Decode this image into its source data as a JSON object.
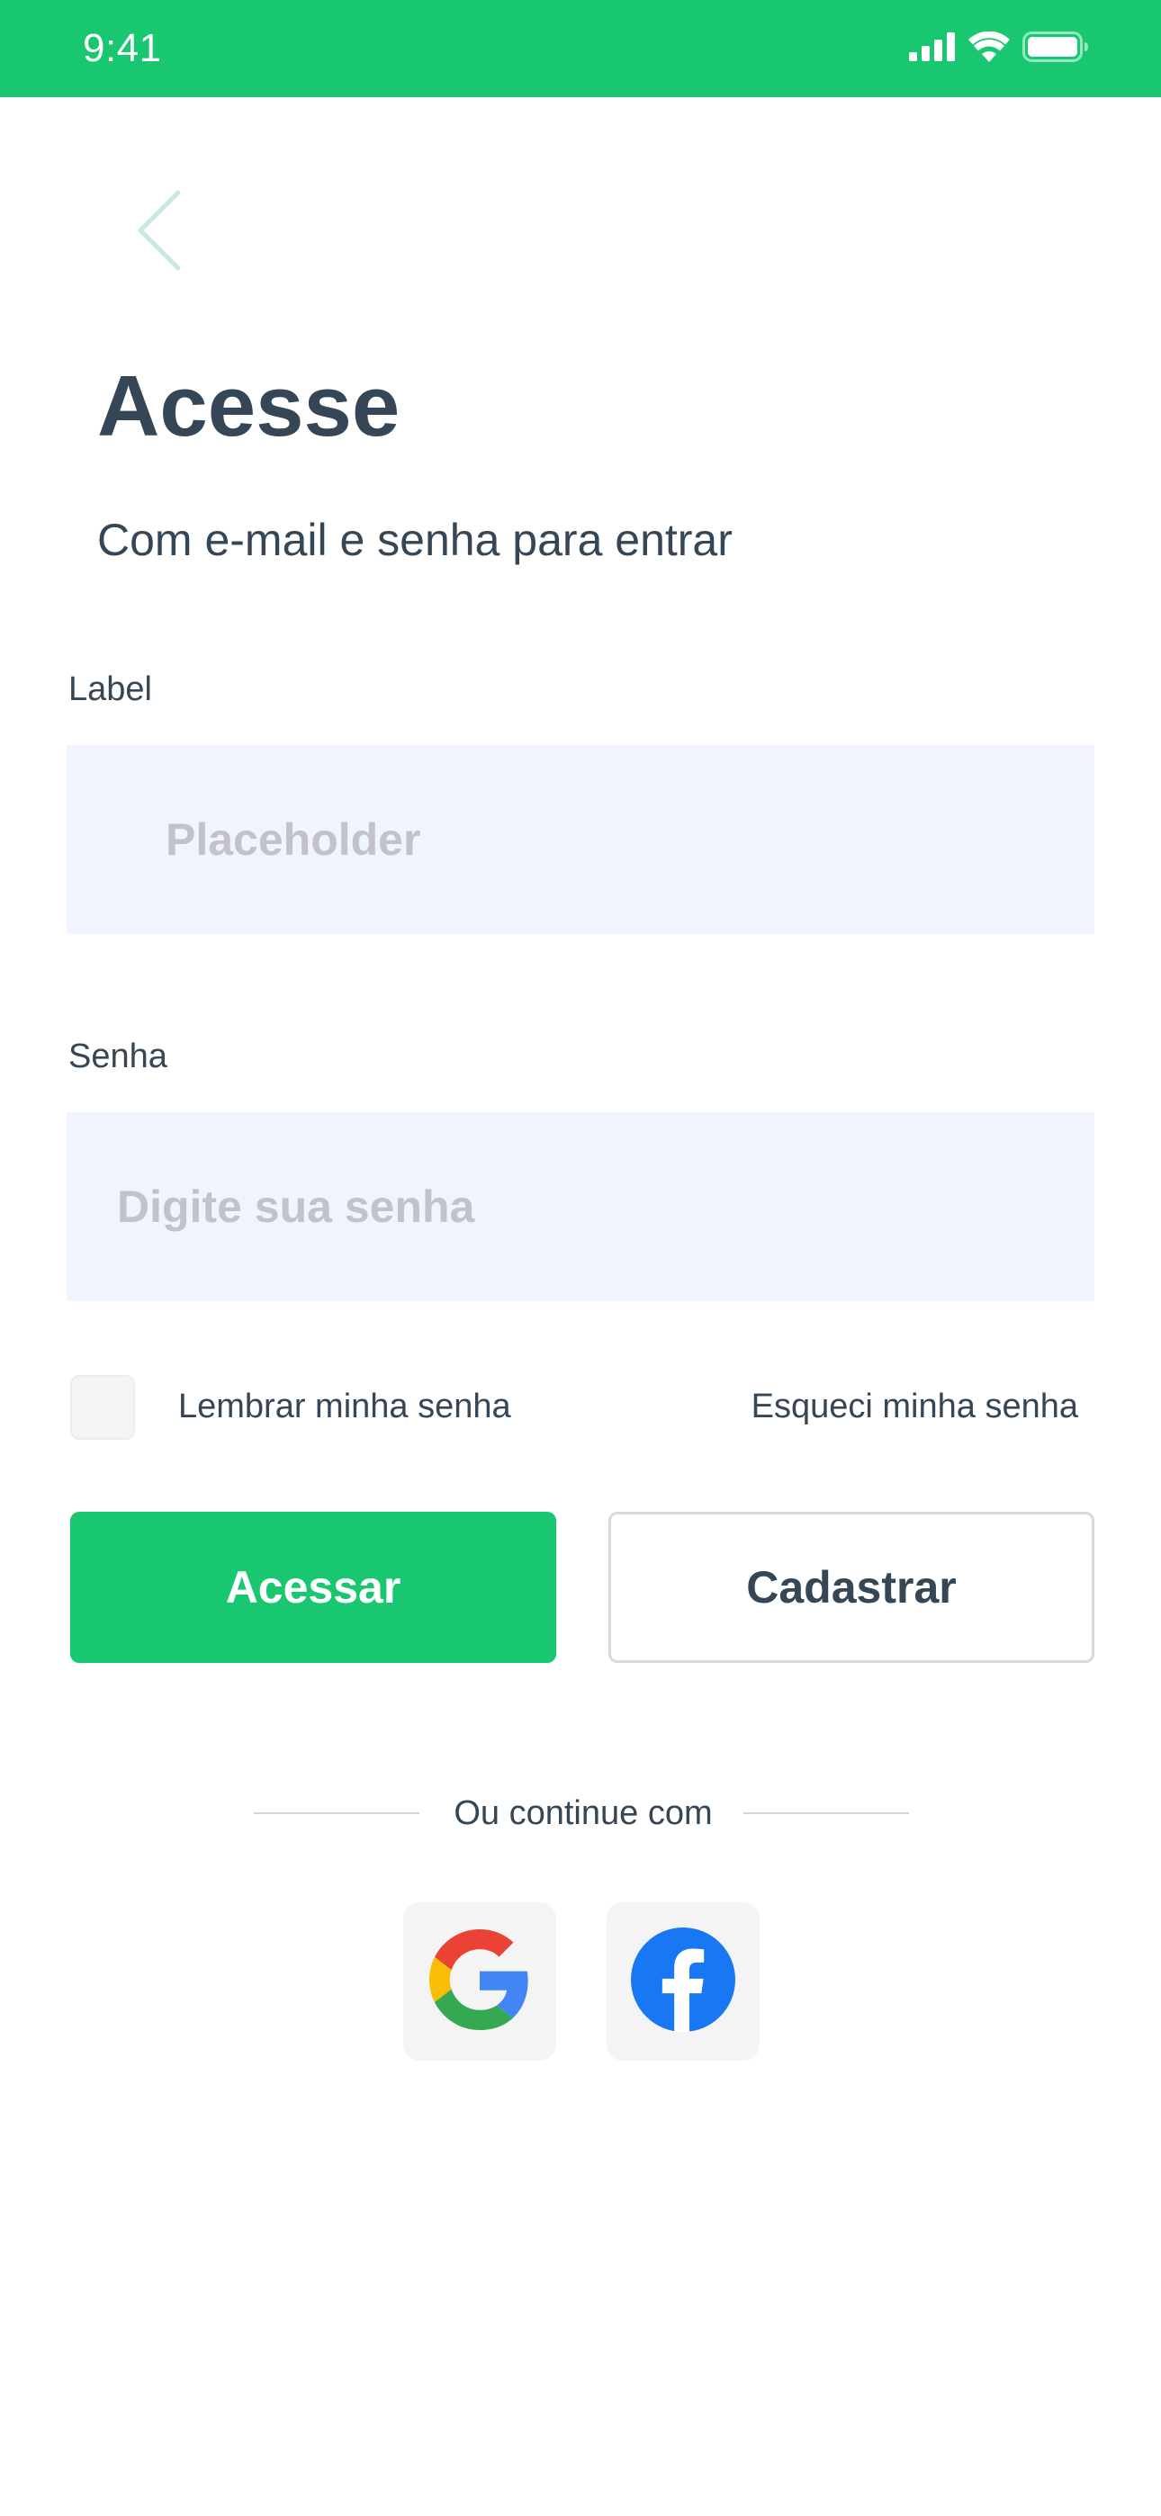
{
  "status_bar": {
    "time": "9:41",
    "background": "#18c76f",
    "icons": [
      "signal-icon",
      "wifi-icon",
      "battery-icon"
    ]
  },
  "header": {
    "back_icon": "chevron-left-icon",
    "title": "Acesse",
    "subtitle": "Com e-mail e senha para entrar"
  },
  "form": {
    "email": {
      "label": "Label",
      "placeholder": "Placeholder",
      "value": ""
    },
    "password": {
      "label": "Senha",
      "placeholder": "Digite sua senha",
      "value": ""
    },
    "remember": {
      "label": "Lembrar minha senha",
      "checked": false
    },
    "forgot_label": "Esqueci minha senha"
  },
  "actions": {
    "login_label": "Acessar",
    "signup_label": "Cadastrar"
  },
  "social": {
    "divider_text": "Ou continue com",
    "providers": [
      {
        "name": "Google",
        "icon": "google-icon"
      },
      {
        "name": "Facebook",
        "icon": "facebook-icon"
      }
    ]
  },
  "colors": {
    "accent": "#18c76f",
    "text": "#354656",
    "input_bg": "#f0f4fd",
    "placeholder": "#c2c2c8",
    "facebook_blue": "#1877f2"
  }
}
